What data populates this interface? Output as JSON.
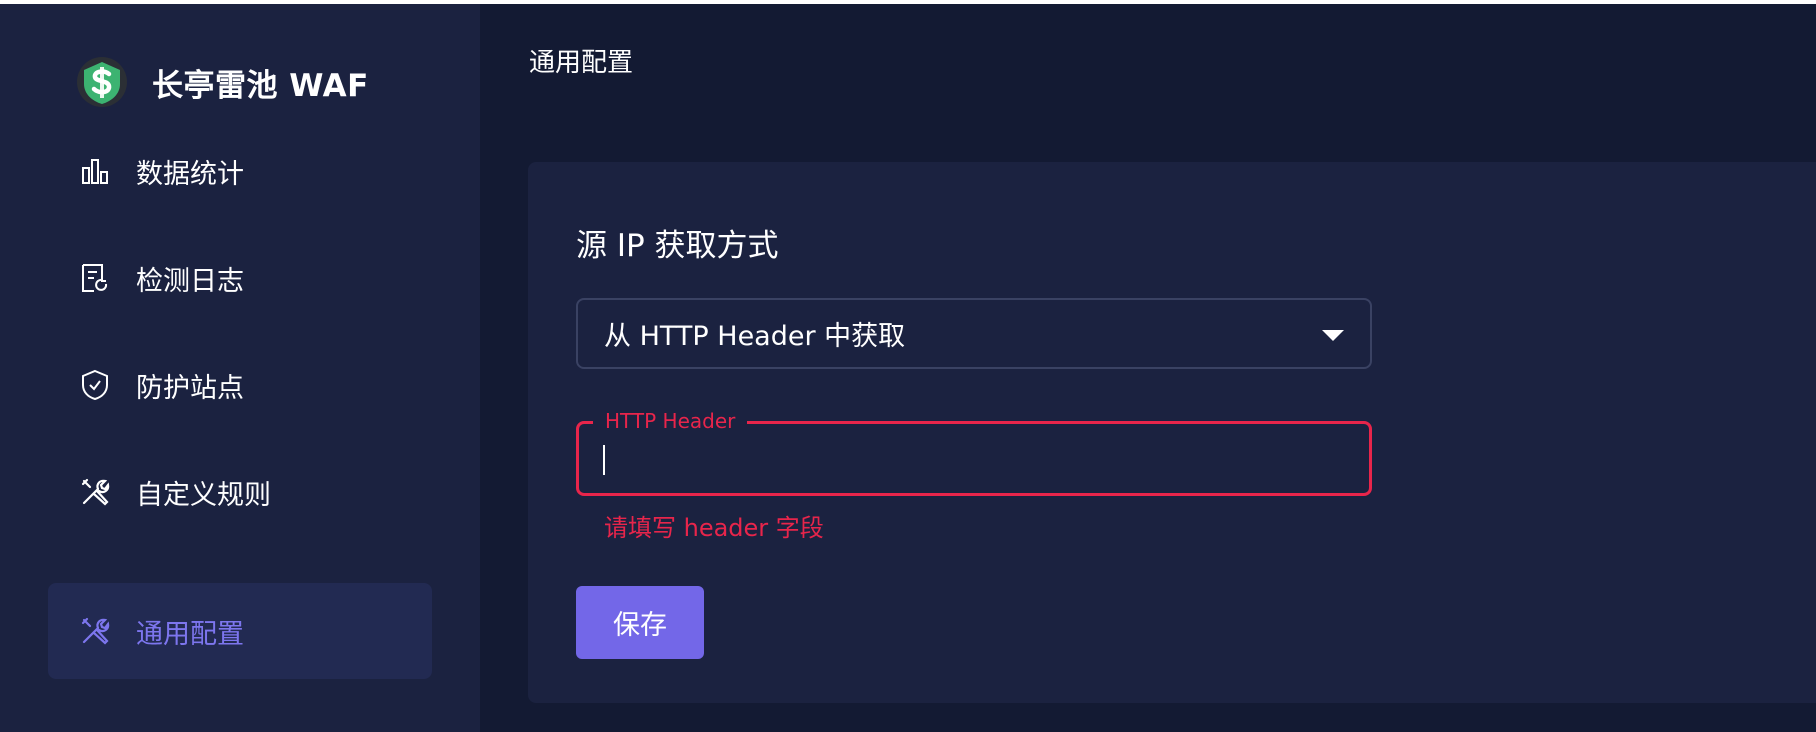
{
  "app": {
    "title": "长亭雷池 WAF"
  },
  "sidebar": {
    "items": [
      {
        "label": "数据统计",
        "icon": "bar-chart-icon",
        "active": false
      },
      {
        "label": "检测日志",
        "icon": "log-document-icon",
        "active": false
      },
      {
        "label": "防护站点",
        "icon": "shield-check-icon",
        "active": false
      },
      {
        "label": "自定义规则",
        "icon": "tools-icon",
        "active": false
      },
      {
        "label": "通用配置",
        "icon": "tools-icon",
        "active": true
      }
    ]
  },
  "page": {
    "title": "通用配置"
  },
  "card": {
    "section_title": "源 IP 获取方式",
    "ip_source_select": {
      "value": "从 HTTP Header 中获取"
    },
    "http_header_input": {
      "label": "HTTP Header",
      "value": "",
      "error": "请填写 header 字段"
    },
    "save_label": "保存"
  },
  "colors": {
    "background": "#131a33",
    "panel": "#1b2240",
    "accent": "#7367e8",
    "active_text": "#7d76ee",
    "error": "#e8254b"
  }
}
